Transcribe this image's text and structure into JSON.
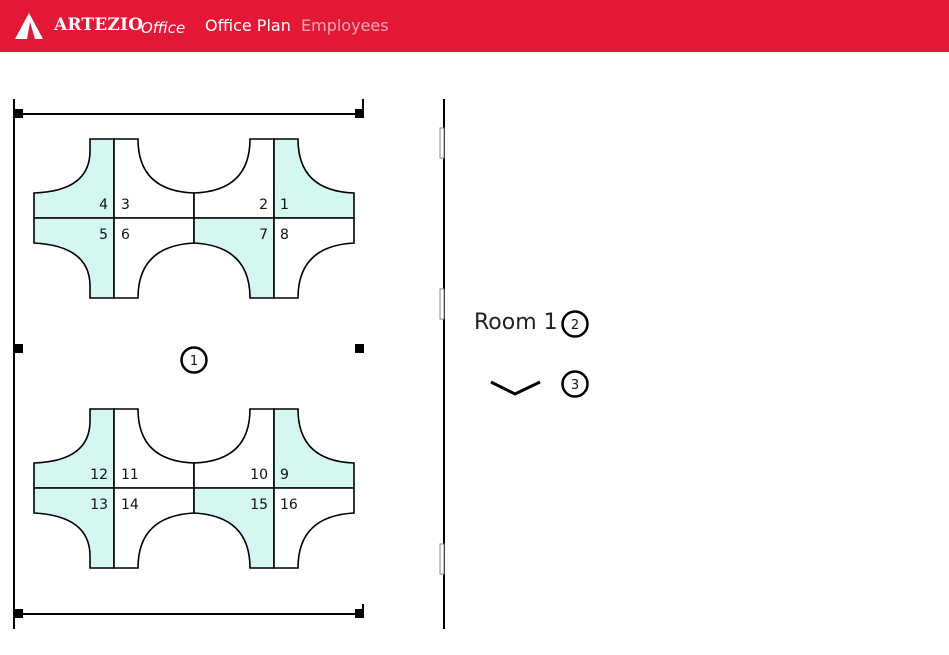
{
  "header": {
    "brand_name": "ARTEZIO",
    "brand_sub": "Office",
    "nav": [
      {
        "label": "Office Plan",
        "active": true
      },
      {
        "label": "Employees",
        "active": false
      }
    ]
  },
  "colors": {
    "header_bg": "#e31836",
    "desk_fill": "#d4f7f2",
    "outline": "#000000"
  },
  "room": {
    "badge": "1",
    "desk_clusters": [
      {
        "desks": [
          "4",
          "3",
          "2",
          "1",
          "5",
          "6",
          "7",
          "8"
        ]
      },
      {
        "desks": [
          "12",
          "11",
          "10",
          "9",
          "13",
          "14",
          "15",
          "16"
        ]
      }
    ]
  },
  "panel": {
    "title": "Room 1",
    "title_badge": "2",
    "toggle_badge": "3",
    "toggle_icon": "chevron-down-icon"
  }
}
